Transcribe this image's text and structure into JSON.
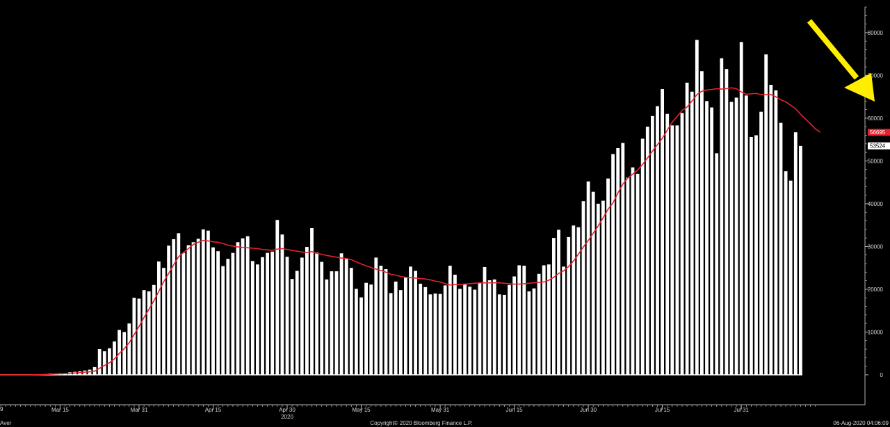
{
  "chart_data": {
    "type": "bar",
    "start_date": "2020-03-01",
    "ylim": [
      -7000,
      86000
    ],
    "y_ticks": [
      0,
      10000,
      20000,
      30000,
      40000,
      50000,
      60000,
      70000,
      80000
    ],
    "x_tick_labels": [
      {
        "date": "2020-03-15",
        "label": "Mar 15"
      },
      {
        "date": "2020-03-31",
        "label": "Mar 31"
      },
      {
        "date": "2020-04-15",
        "label": "Apr 15"
      },
      {
        "date": "2020-04-30",
        "label": "Apr 30"
      },
      {
        "date": "2020-05-15",
        "label": "May 15"
      },
      {
        "date": "2020-05-31",
        "label": "May 31"
      },
      {
        "date": "2020-06-15",
        "label": "Jun 15"
      },
      {
        "date": "2020-06-30",
        "label": "Jun 30"
      },
      {
        "date": "2020-07-15",
        "label": "Jul 15"
      },
      {
        "date": "2020-07-31",
        "label": "Jul 31"
      }
    ],
    "year_label": "2020",
    "series": [
      {
        "type": "bar",
        "color": "#ffffff",
        "values": [
          0,
          0,
          0,
          0,
          0,
          0,
          0,
          0,
          0,
          100,
          100,
          200,
          300,
          300,
          400,
          400,
          600,
          700,
          800,
          1000,
          1200,
          1800,
          6000,
          5500,
          6200,
          7800,
          10500,
          10000,
          12000,
          18000,
          17800,
          19800,
          19500,
          21000,
          26500,
          25000,
          30200,
          31700,
          33100,
          28500,
          30300,
          31000,
          31800,
          34000,
          33700,
          29800,
          28900,
          25400,
          27100,
          28500,
          31000,
          31900,
          32400,
          26600,
          25800,
          27500,
          28500,
          28800,
          36200,
          32800,
          27600,
          22400,
          24300,
          27400,
          29900,
          34300,
          28600,
          26400,
          22300,
          24200,
          24200,
          28400,
          27100,
          25000,
          20100,
          18100,
          21500,
          21100,
          27400,
          25500,
          24700,
          19100,
          21800,
          19800,
          22900,
          25300,
          24300,
          21300,
          20500,
          18800,
          19000,
          18900,
          20900,
          25500,
          23400,
          20100,
          21300,
          20600,
          19900,
          21600,
          25200,
          22100,
          22300,
          18800,
          18700,
          21000,
          23000,
          25600,
          25500,
          19500,
          20200,
          23600,
          25600,
          25800,
          32000,
          33900,
          25300,
          32200,
          34900,
          34500,
          40600,
          45200,
          42800,
          40000,
          40700,
          45900,
          51600,
          53000,
          54200,
          46100,
          48500,
          47000,
          55200,
          58000,
          60500,
          62800,
          66800,
          61000,
          58300,
          58300,
          61200,
          68300,
          66200,
          78300,
          71000,
          64000,
          62500,
          51800,
          74000,
          71500,
          63800,
          64800,
          77800,
          65300,
          55600,
          56000,
          61500,
          74900,
          67800,
          66500,
          58900,
          47600,
          45400,
          56700,
          53500
        ]
      },
      {
        "type": "line",
        "color": "#e8202c",
        "values": [
          0,
          0,
          0,
          0,
          0,
          0,
          0,
          0,
          0,
          50,
          70,
          100,
          150,
          200,
          250,
          300,
          350,
          430,
          520,
          610,
          720,
          860,
          1530,
          2200,
          2800,
          3700,
          5000,
          6100,
          7500,
          9400,
          11300,
          13400,
          15300,
          17300,
          19500,
          21800,
          23700,
          25700,
          27600,
          28600,
          29500,
          30500,
          31000,
          31400,
          31300,
          31100,
          31000,
          30700,
          30300,
          30100,
          29900,
          29800,
          29700,
          29600,
          29500,
          29300,
          29200,
          29100,
          29400,
          29500,
          29300,
          29100,
          28900,
          28700,
          28600,
          28800,
          28400,
          28200,
          27900,
          27700,
          27500,
          27300,
          27200,
          26900,
          26400,
          25900,
          25500,
          25100,
          24700,
          24400,
          24000,
          23500,
          23300,
          23000,
          22800,
          22700,
          22600,
          22500,
          22400,
          22200,
          21900,
          21700,
          21300,
          21000,
          21100,
          21100,
          21200,
          21300,
          21400,
          21500,
          21500,
          21500,
          21500,
          21500,
          21400,
          21300,
          21200,
          21200,
          21300,
          21400,
          21500,
          21600,
          21700,
          22100,
          22800,
          23700,
          24300,
          25300,
          26600,
          28200,
          29900,
          31400,
          33100,
          34800,
          36700,
          38700,
          40200,
          42500,
          44600,
          46000,
          46900,
          47900,
          49200,
          50700,
          52300,
          53800,
          55300,
          57200,
          59100,
          60400,
          61800,
          62600,
          64000,
          65500,
          66300,
          66600,
          66700,
          66900,
          66800,
          66900,
          67100,
          66900,
          66100,
          65600,
          65700,
          65800,
          65500,
          65500,
          65500,
          65000,
          64300,
          63800,
          63000,
          62200,
          60900,
          59800,
          58700,
          57500,
          56695
        ]
      }
    ],
    "last_values": [
      {
        "label": "56695",
        "value": 56695,
        "bg": "#e8202c",
        "fg": "#ffffff"
      },
      {
        "label": "53524",
        "value": 53524,
        "bg": "#ffffff",
        "fg": "#000000"
      }
    ],
    "annotation_arrow_color": "#ffee00"
  },
  "footer": {
    "left_text": "Aver",
    "copyright": "Copyright© 2020 Bloomberg Finance L.P.",
    "timestamp": "06-Aug-2020 04:06:09",
    "corner_label": "9"
  },
  "colors": {
    "background": "#000000",
    "axis": "#b5b5b5",
    "text": "#d8d8d8"
  }
}
